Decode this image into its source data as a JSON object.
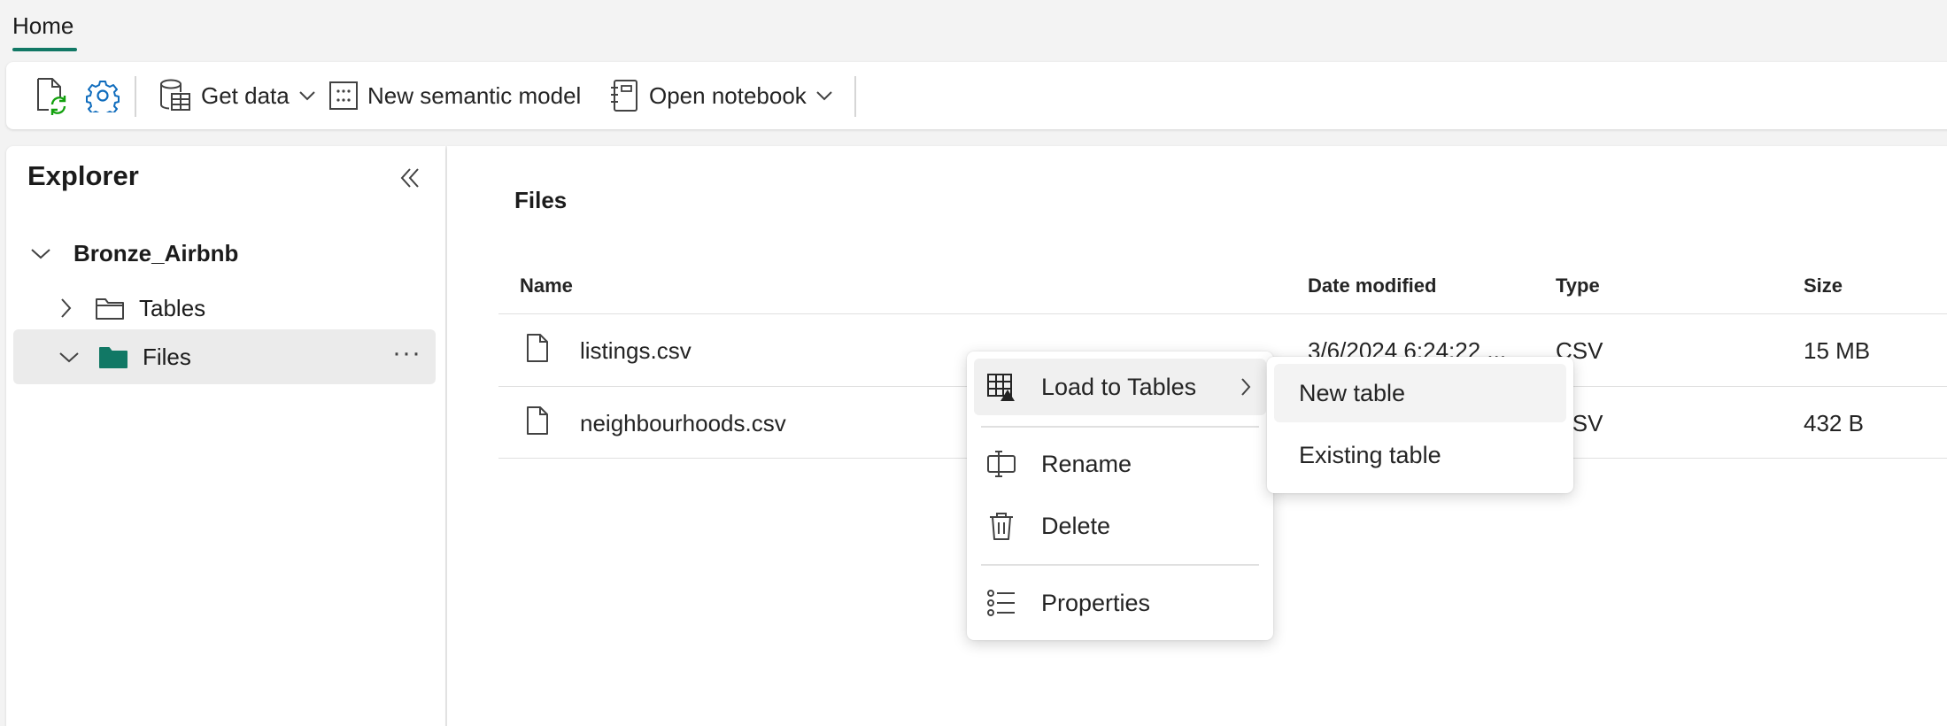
{
  "tabbar": {
    "home_label": "Home"
  },
  "ribbon": {
    "get_data_label": "Get data",
    "new_semantic_model_label": "New semantic model",
    "open_notebook_label": "Open notebook"
  },
  "explorer": {
    "title": "Explorer",
    "root": "Bronze_Airbnb",
    "items": [
      {
        "label": "Tables",
        "icon": "folder-outline-icon",
        "expanded": false
      },
      {
        "label": "Files",
        "icon": "folder-filled-icon",
        "expanded": true,
        "selected": true
      }
    ],
    "more_label": "···"
  },
  "main": {
    "title": "Files",
    "columns": {
      "name": "Name",
      "date_modified": "Date modified",
      "type": "Type",
      "size": "Size"
    },
    "rows": [
      {
        "name": "listings.csv",
        "date_modified": "3/6/2024 6:24:22 ...",
        "type": "CSV",
        "size": "15 MB"
      },
      {
        "name": "neighbourhoods.csv",
        "date_modified": "",
        "type": "CSV",
        "size": "432 B"
      }
    ]
  },
  "context_menu": {
    "items": [
      {
        "label": "Load to Tables",
        "icon": "table-load-icon",
        "has_submenu": true
      },
      {
        "label": "Rename",
        "icon": "rename-icon"
      },
      {
        "label": "Delete",
        "icon": "trash-icon"
      },
      {
        "label": "Properties",
        "icon": "properties-list-icon"
      }
    ],
    "submenu": [
      {
        "label": "New table"
      },
      {
        "label": "Existing table"
      }
    ]
  },
  "colors": {
    "accent": "#117865",
    "folder_fill": "#117865",
    "settings_icon": "#0f6cbd",
    "refresh_icon": "#13a10e"
  }
}
